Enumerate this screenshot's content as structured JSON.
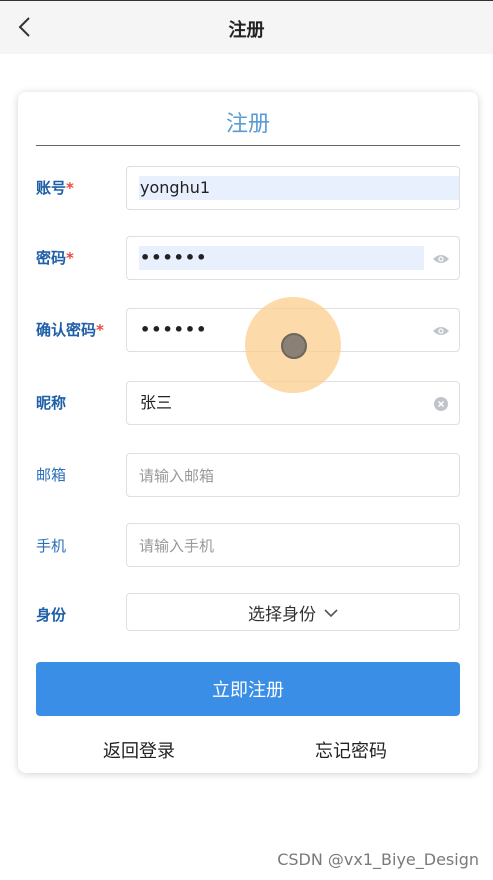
{
  "header": {
    "title": "注册"
  },
  "form": {
    "title": "注册",
    "account": {
      "label": "账号",
      "required_mark": "*",
      "value": "yonghu1"
    },
    "password": {
      "label": "密码",
      "required_mark": "*",
      "value": "••••••"
    },
    "confirm_password": {
      "label": "确认密码",
      "required_mark": "*",
      "value": "••••••"
    },
    "nickname": {
      "label": "昵称",
      "value": "张三"
    },
    "email": {
      "label": "邮箱",
      "placeholder": "请输入邮箱"
    },
    "phone": {
      "label": "手机",
      "placeholder": "请输入手机"
    },
    "identity": {
      "label": "身份",
      "selected": "选择身份"
    },
    "submit_label": "立即注册",
    "back_login": "返回登录",
    "forgot_password": "忘记密码"
  },
  "watermark": "CSDN @vx1_Biye_Design",
  "colors": {
    "label_blue": "#1f5fa8",
    "title_blue": "#5b9bd5",
    "button_blue": "#3a8ee6",
    "required_red": "#e74c3c"
  }
}
